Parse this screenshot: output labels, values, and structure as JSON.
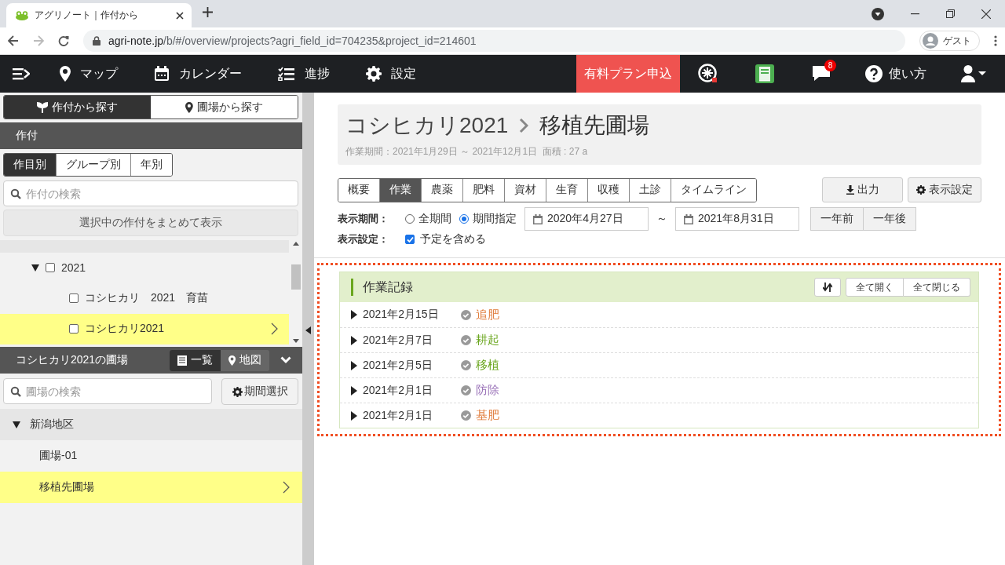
{
  "browser": {
    "tab_title": "アグリノート｜作付から",
    "url_host": "agri-note.jp",
    "url_path": "/b/#/overview/projects?agri_field_id=704235&project_id=214601",
    "profile": "ゲスト"
  },
  "nav": {
    "items": [
      {
        "kind": "map",
        "label": "マップ"
      },
      {
        "kind": "calendar",
        "label": "カレンダー"
      },
      {
        "kind": "progress",
        "label": "進捗"
      },
      {
        "kind": "settings",
        "label": "設定"
      }
    ],
    "plan_button": "有料プラン申込",
    "message_count": "8",
    "help": "使い方"
  },
  "sidebar": {
    "search_modes": [
      {
        "kind": "crop",
        "label": "作付から探す",
        "selected": true
      },
      {
        "kind": "field",
        "label": "圃場から探す",
        "selected": false
      }
    ],
    "crop_section": "作付",
    "crop_tabs": [
      {
        "label": "作目別",
        "selected": true
      },
      {
        "label": "グループ別",
        "selected": false
      },
      {
        "label": "年別",
        "selected": false
      }
    ],
    "crop_search": {
      "placeholder": "作付の検索"
    },
    "bulk_button": "選択中の作付をまとめて表示",
    "crop_tree": [
      {
        "label": "2021",
        "expanded": true,
        "checked": false,
        "children": [
          {
            "label": "コシヒカリ　2021　育苗",
            "checked": false,
            "selected": false
          },
          {
            "label": "コシヒカリ2021",
            "checked": false,
            "selected": true
          }
        ]
      }
    ],
    "fields_title": "コシヒカリ2021の圃場",
    "view_modes": [
      {
        "kind": "list",
        "label": "一覧",
        "selected": true
      },
      {
        "kind": "map",
        "label": "地図",
        "selected": false
      }
    ],
    "field_search": {
      "placeholder": "圃場の検索"
    },
    "period_button": "期間選択",
    "field_tree": [
      {
        "label": "新潟地区",
        "expanded": true,
        "children": [
          {
            "label": "圃場-01",
            "selected": false
          },
          {
            "label": "移植先圃場",
            "selected": true
          }
        ]
      }
    ]
  },
  "main": {
    "crop": "コシヒカリ2021",
    "field": "移植先圃場",
    "meta": "作業期間：2021年1月29日 ～ 2021年12月1日  面積 : 27 a",
    "tabs": [
      {
        "label": "概要",
        "selected": false
      },
      {
        "label": "作業",
        "selected": true
      },
      {
        "label": "農薬",
        "selected": false
      },
      {
        "label": "肥料",
        "selected": false
      },
      {
        "label": "資材",
        "selected": false
      },
      {
        "label": "生育",
        "selected": false
      },
      {
        "label": "収穫",
        "selected": false
      },
      {
        "label": "土診",
        "selected": false
      },
      {
        "label": "タイムライン",
        "selected": false
      }
    ],
    "export_button": "出力",
    "display_button": "表示設定",
    "period_label": "表示期間：",
    "period_options": [
      {
        "label": "全期間",
        "selected": false
      },
      {
        "label": "期間指定",
        "selected": true
      }
    ],
    "date_from": "2020年4月27日",
    "range_sep": "～",
    "date_to": "2021年8月31日",
    "year_buttons": [
      "一年前",
      "一年後"
    ],
    "settings_label": "表示設定：",
    "include_plans": {
      "label": "予定を含める",
      "checked": true
    },
    "records": {
      "title": "作業記録",
      "expand_all": "全て開く",
      "collapse_all": "全て閉じる",
      "rows": [
        {
          "date": "2021年2月15日",
          "task": "追肥",
          "color": "#e07b39",
          "expanded": false
        },
        {
          "date": "2021年2月7日",
          "task": "耕起",
          "color": "#6aa61e",
          "expanded": false
        },
        {
          "date": "2021年2月5日",
          "task": "移植",
          "color": "#6aa61e",
          "expanded": false
        },
        {
          "date": "2021年2月1日",
          "task": "防除",
          "color": "#9a72b8",
          "expanded": false
        },
        {
          "date": "2021年2月1日",
          "task": "基肥",
          "color": "#e07b39",
          "expanded": false
        }
      ]
    }
  }
}
